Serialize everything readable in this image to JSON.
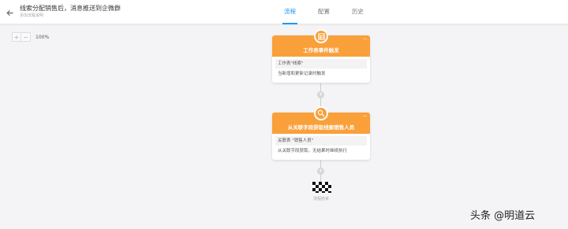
{
  "header": {
    "title": "线索分配销售后，消息推送到企微群",
    "subtitle": "添加流程说明"
  },
  "tabs": [
    {
      "label": "流程",
      "active": true
    },
    {
      "label": "配置",
      "active": false
    },
    {
      "label": "历史",
      "active": false
    }
  ],
  "zoom": {
    "zoom_in": "+",
    "zoom_out": "−",
    "level": "100%"
  },
  "flow": {
    "more_label": "···",
    "add_label": "+",
    "nodes": [
      {
        "icon": "table-icon",
        "title": "工作表事件触发",
        "line1": "工作表\"线索\"",
        "line2": "当新增和更新记录时触发"
      },
      {
        "icon": "search-relation-icon",
        "title": "从关联字段获取线索销售人员",
        "line1": "关联表 \"销售人员\"",
        "line2": "从关联字段获取，无结果时继续执行"
      }
    ],
    "end_label": "流程结束"
  },
  "watermark": "头条 @明道云",
  "colors": {
    "accent": "#2196f3",
    "node_orange": "#f9a03b"
  }
}
